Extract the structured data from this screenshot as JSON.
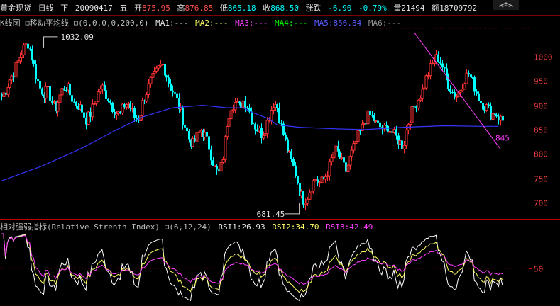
{
  "header": {
    "instrument": "黄金现货",
    "period": "日线",
    "arrow_label": "下",
    "date": "20090417",
    "weekday": "五",
    "open_label": "开",
    "open": "875.95",
    "high_label": "高",
    "high": "876.85",
    "low_label": "低",
    "low": "865.18",
    "close_label": "收",
    "close": "868.50",
    "change_label": "涨跌",
    "change": "-6.90",
    "change_pct": "-0.79%",
    "volume_label": "量",
    "volume": "21494",
    "amount_label": "额",
    "amount": "18709792"
  },
  "ma_bar": {
    "chart_type": "K线图",
    "toggle1": "⊟",
    "indicator": "移动平均线",
    "toggle2": "⊟",
    "params": "(0,0,0,0,200,0)",
    "ma1": "MA1:---",
    "ma2": "MA2:---",
    "ma3": "MA3:---",
    "ma4": "MA4:---",
    "ma5": "MA5:856.84",
    "ma6": "MA6:---"
  },
  "rsi_bar": {
    "indicator": "相对强弱指标(Relative Strenth Index)",
    "toggle": "⊟",
    "params": "(6,12,24)",
    "rsi1": "RSI1:26.93",
    "rsi2": "RSI2:34.70",
    "rsi3": "RSI3:42.49"
  },
  "colors": {
    "up": "#ff3333",
    "down": "#00ffff",
    "ma5": "#3535ff",
    "axis": "#c00000",
    "hline": "#ff40ff",
    "trend": "#ff40ff",
    "rsi1": "#ffffff",
    "rsi2": "#ffff66",
    "rsi3": "#ff40ff"
  },
  "chart_data": [
    {
      "type": "candlestick",
      "y_ticks": [
        "1000",
        "950",
        "900",
        "850",
        "800",
        "750",
        "700"
      ],
      "ylim": [
        680,
        1055
      ],
      "annotations": {
        "high": "1032.09",
        "low": "681.45",
        "support": "845"
      },
      "support_level": 845,
      "ma5_last": 856.84,
      "close_path": [
        918,
        930,
        952,
        965,
        985,
        1005,
        1020,
        1028,
        995,
        960,
        935,
        925,
        930,
        910,
        890,
        915,
        935,
        940,
        920,
        905,
        900,
        890,
        870,
        880,
        900,
        920,
        940,
        925,
        915,
        895,
        885,
        880,
        900,
        905,
        890,
        870,
        875,
        910,
        930,
        950,
        960,
        975,
        985,
        965,
        940,
        925,
        905,
        880,
        855,
        830,
        820,
        835,
        850,
        840,
        820,
        790,
        765,
        760,
        800,
        870,
        900,
        905,
        895,
        910,
        905,
        880,
        860,
        850,
        840,
        855,
        880,
        905,
        900,
        860,
        830,
        800,
        780,
        755,
        720,
        705,
        715,
        735,
        750,
        740,
        745,
        760,
        780,
        810,
        800,
        780,
        765,
        790,
        810,
        835,
        850,
        870,
        880,
        875,
        860,
        855,
        850,
        855,
        845,
        835,
        825,
        815,
        860,
        880,
        900,
        915,
        930,
        955,
        975,
        990,
        1000,
        985,
        960,
        940,
        925,
        920,
        935,
        955,
        965,
        950,
        930,
        910,
        900,
        895,
        880,
        885,
        875,
        868.5
      ],
      "ma5_path": [
        {
          "i": 0,
          "v": 745
        },
        {
          "i": 20,
          "v": 775
        },
        {
          "i": 40,
          "v": 812
        },
        {
          "i": 55,
          "v": 845
        },
        {
          "i": 70,
          "v": 876
        },
        {
          "i": 85,
          "v": 895
        },
        {
          "i": 100,
          "v": 900
        },
        {
          "i": 112,
          "v": 895
        },
        {
          "i": 120,
          "v": 895
        },
        {
          "i": 125,
          "v": 885
        },
        {
          "i": 133,
          "v": 872
        },
        {
          "i": 137,
          "v": 860
        },
        {
          "i": 148,
          "v": 855
        },
        {
          "i": 165,
          "v": 852
        },
        {
          "i": 180,
          "v": 850
        },
        {
          "i": 200,
          "v": 855
        },
        {
          "i": 220,
          "v": 858
        },
        {
          "i": 235,
          "v": 857
        },
        {
          "i": 247,
          "v": 856.84
        }
      ],
      "trendline": {
        "from": {
          "i": 205,
          "v": 1050
        },
        "to": {
          "i": 248,
          "v": 810
        }
      }
    },
    {
      "type": "line",
      "name": "RSI",
      "y_ticks": [
        "50"
      ],
      "ylim": [
        0,
        100
      ],
      "series": [
        {
          "name": "RSI1",
          "final": 26.93
        },
        {
          "name": "RSI2",
          "final": 34.7
        },
        {
          "name": "RSI3",
          "final": 42.49
        }
      ]
    }
  ]
}
